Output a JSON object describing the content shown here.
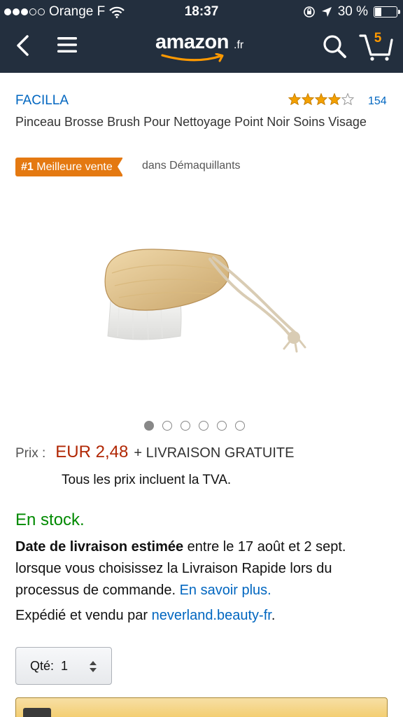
{
  "status_bar": {
    "carrier": "Orange F",
    "time": "18:37",
    "battery": "30 %",
    "battery_level": 0.3,
    "signal_bars_filled": 3,
    "signal_bars_total": 5
  },
  "header": {
    "logo_text": "amazon",
    "logo_tld": ".fr",
    "cart_count": "5",
    "colors": {
      "background": "#232f3e",
      "accent": "#ff9900"
    }
  },
  "product": {
    "brand": "FACILLA",
    "rating_stars": 4,
    "rating_count": "154",
    "title": "Pinceau Brosse Brush Pour Nettoyage Point Noir Soins Visage",
    "bestseller_rank": "#1",
    "bestseller_label": "Meilleure vente",
    "bestseller_category": "dans Démaquillants",
    "image_count": 6,
    "active_image_index": 0
  },
  "pricing": {
    "label": "Prix :",
    "value": "EUR 2,48",
    "delivery": "+ LIVRAISON GRATUITE",
    "vat_note": "Tous les prix incluent la TVA."
  },
  "availability": {
    "stock": "En stock.",
    "delivery_bold": "Date de livraison estimée",
    "delivery_text": " entre le 17 août et 2 sept. lorsque vous choisissez la Livraison Rapide lors du processus de commande. ",
    "learn_more": "En savoir plus.",
    "seller_prefix": "Expédié et vendu par ",
    "seller_name": "neverland.beauty-fr",
    "seller_suffix": "."
  },
  "quantity": {
    "label": "Qté:",
    "value": "1"
  },
  "colors": {
    "link": "#0066c0",
    "price": "#b12704",
    "in_stock": "#008a00",
    "bestseller": "#e47911",
    "star": "#f4a100"
  }
}
